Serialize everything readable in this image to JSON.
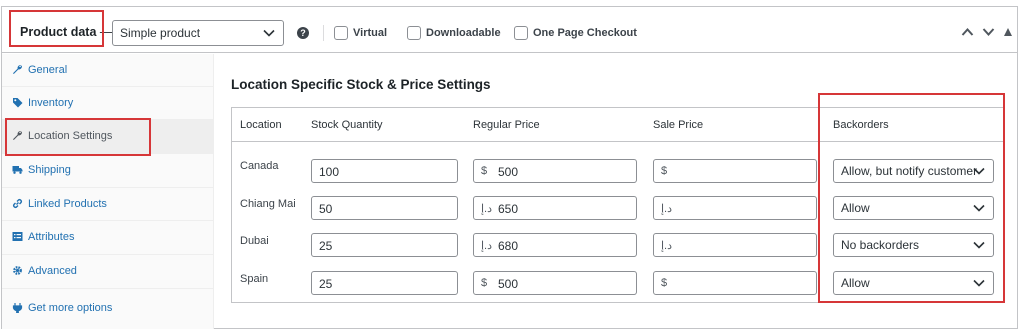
{
  "header": {
    "product_data_label": "Product data",
    "dash": "—",
    "product_type": "Simple product",
    "help": "?",
    "checkboxes": [
      "Virtual",
      "Downloadable",
      "One Page Checkout"
    ]
  },
  "sidebar": {
    "items": [
      {
        "label": "General",
        "icon": "wrench-icon"
      },
      {
        "label": "Inventory",
        "icon": "tag-icon"
      },
      {
        "label": "Location Settings",
        "icon": "wrench-icon",
        "active": true
      },
      {
        "label": "Shipping",
        "icon": "truck-icon"
      },
      {
        "label": "Linked Products",
        "icon": "link-icon"
      },
      {
        "label": "Attributes",
        "icon": "list-icon"
      },
      {
        "label": "Advanced",
        "icon": "gear-icon"
      },
      {
        "label": "Get more options",
        "icon": "plugin-icon"
      }
    ]
  },
  "main": {
    "title": "Location Specific Stock & Price Settings",
    "columns": [
      "Location",
      "Stock Quantity",
      "Regular Price",
      "Sale Price",
      "Backorders"
    ],
    "rows": [
      {
        "location": "Canada",
        "stock": "100",
        "currency": "$",
        "regular": "500",
        "sale_currency": "$",
        "sale": "",
        "backorders": "Allow, but notify customer"
      },
      {
        "location": "Chiang Mai",
        "stock": "50",
        "currency": "د.إ",
        "regular": "650",
        "sale_currency": "د.إ",
        "sale": "",
        "backorders": "Allow"
      },
      {
        "location": "Dubai",
        "stock": "25",
        "currency": "د.إ",
        "regular": "680",
        "sale_currency": "د.إ",
        "sale": "",
        "backorders": "No backorders"
      },
      {
        "location": "Spain",
        "stock": "25",
        "currency": "$",
        "regular": "500",
        "sale_currency": "$",
        "sale": "",
        "backorders": "Allow"
      }
    ]
  },
  "colors": {
    "highlight": "#d63638",
    "link": "#2271b1",
    "border": "#c3c4c7"
  }
}
